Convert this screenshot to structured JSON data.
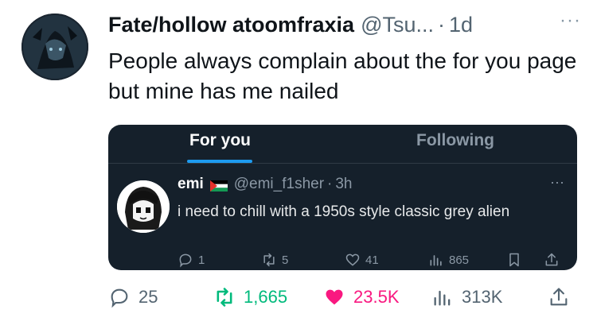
{
  "tweet": {
    "author_name": "Fate/hollow atoomfraxia",
    "handle": "@Tsu...",
    "separator": "·",
    "time": "1d",
    "more_label": "···",
    "text": "People always complain about the for you page but mine has me nailed"
  },
  "embedded": {
    "tabs": [
      {
        "label": "For you",
        "active": true
      },
      {
        "label": "Following",
        "active": false
      }
    ],
    "post": {
      "name": "emi",
      "handle": "@emi_f1sher",
      "separator": "·",
      "time": "3h",
      "more_label": "···",
      "text": "i need to chill with a 1950s style classic grey alien",
      "actions": {
        "replies": "1",
        "reposts": "5",
        "likes": "41",
        "views": "865"
      }
    }
  },
  "actions": {
    "replies": "25",
    "reposts": "1,665",
    "likes": "23.5K",
    "views": "313K"
  },
  "colors": {
    "like": "#f91880",
    "repost": "#00ba7c",
    "accent": "#1d9bf0",
    "embed_bg": "#15202b"
  }
}
